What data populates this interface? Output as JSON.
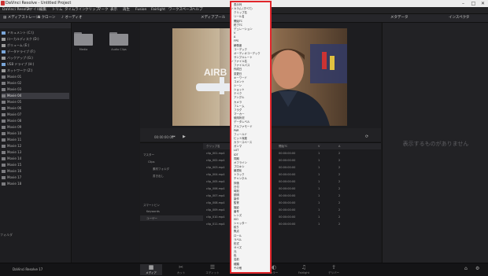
{
  "window": {
    "title": "DaVinci Resolve - Untitled Project"
  },
  "menubar": {
    "items": [
      "DaVinci Resolve",
      "ファイル",
      "編集",
      "トリム",
      "タイムライン",
      "クリップ",
      "マーク",
      "表示",
      "再生",
      "Fusion",
      "Fairlight",
      "ワークスペース",
      "ヘルプ"
    ]
  },
  "toolbar": {
    "media_storage": "メディアストレージ",
    "clone": "クローン",
    "audio": "オーディオ",
    "media_pool": "メディアプール",
    "metadata": "メタデータ",
    "inspector": "インスペクタ"
  },
  "left_panel": {
    "items": [
      {
        "label": "ドキュメント (C:\\)",
        "sel": false
      },
      {
        "label": "ローカルディスク (D:)",
        "sel": false
      },
      {
        "label": "ボリューム (E:)",
        "sel": false
      },
      {
        "label": "データドライブ (F:)",
        "sel": false
      },
      {
        "label": "バックアップ (G:)",
        "sel": false
      },
      {
        "label": "USB ドライブ (H:)",
        "sel": false
      },
      {
        "label": "ネットワーク (Z:)",
        "sel": false
      },
      {
        "label": "Movie 01",
        "sel": false
      },
      {
        "label": "Movie 02",
        "sel": false
      },
      {
        "label": "Movie 03",
        "sel": false
      },
      {
        "label": "Movie 04",
        "sel": true
      },
      {
        "label": "Movie 05",
        "sel": false
      },
      {
        "label": "Movie 06",
        "sel": false
      },
      {
        "label": "Movie 07",
        "sel": false
      },
      {
        "label": "Movie 08",
        "sel": false
      },
      {
        "label": "Movie 09",
        "sel": false
      },
      {
        "label": "Movie 10",
        "sel": false
      },
      {
        "label": "Movie 11",
        "sel": false
      },
      {
        "label": "Movie 12",
        "sel": false
      },
      {
        "label": "Movie 13",
        "sel": false
      },
      {
        "label": "Movie 14",
        "sel": false
      },
      {
        "label": "Movie 15",
        "sel": false
      },
      {
        "label": "Movie 16",
        "sel": false
      },
      {
        "label": "Movie 17",
        "sel": false
      },
      {
        "label": "Movie 18",
        "sel": false
      }
    ],
    "footer": "フォルダ"
  },
  "bin": {
    "folders": [
      "Media",
      "Audio Clips"
    ]
  },
  "viewer": {
    "timecode": "00:00:00:00"
  },
  "mediapool": {
    "tree": [
      "マスター",
      "Clips",
      "素材フォルダ",
      "書き出し"
    ],
    "smart_bins": "スマートビン",
    "smart_items": [
      "Keywords",
      "ユーザー"
    ],
    "columns": [
      "クリップ名",
      "リール名",
      "開始TC",
      "V",
      "A"
    ],
    "rows": [
      [
        "clip_001.mp4",
        "",
        "00:00:00:00",
        "1",
        "2"
      ],
      [
        "clip_002.mp4",
        "",
        "00:00:00:00",
        "1",
        "2"
      ],
      [
        "clip_003.mp4",
        "",
        "00:00:00:00",
        "1",
        "2"
      ],
      [
        "clip_004.mp4",
        "",
        "00:00:00:00",
        "1",
        "2"
      ],
      [
        "clip_005.mp4",
        "",
        "00:00:00:00",
        "1",
        "2"
      ],
      [
        "clip_006.mp4",
        "",
        "00:00:00:00",
        "1",
        "2"
      ],
      [
        "clip_007.mp4",
        "",
        "00:00:00:00",
        "1",
        "2"
      ],
      [
        "clip_008.mp4",
        "",
        "00:00:00:00",
        "1",
        "2"
      ],
      [
        "clip_009.mp4",
        "",
        "00:00:00:00",
        "1",
        "2"
      ],
      [
        "clip_010.mp4",
        "",
        "00:00:00:00",
        "1",
        "2"
      ],
      [
        "clip_011.mp4",
        "",
        "00:00:00:00",
        "1",
        "2"
      ]
    ]
  },
  "inspector": {
    "empty_text": "表示するものがありません"
  },
  "pagebar": {
    "project": "DaVinci Resolve 17",
    "pages": [
      {
        "glyph": "▦",
        "label": "メディア",
        "active": true
      },
      {
        "glyph": "✂",
        "label": "カット",
        "active": false
      },
      {
        "glyph": "☰",
        "label": "エディット",
        "active": false
      },
      {
        "glyph": "◎",
        "label": "Fusion",
        "active": false
      },
      {
        "glyph": "◐",
        "label": "カラー",
        "active": false
      },
      {
        "glyph": "♫",
        "label": "Fairlight",
        "active": false
      },
      {
        "glyph": "⇪",
        "label": "デリバー",
        "active": false
      }
    ]
  },
  "dropdown": {
    "items": [
      {
        "label": "表示列",
        "check": false
      },
      {
        "label": "カラム (すべて)",
        "check": true
      },
      {
        "label": "クリップ名",
        "check": false
      },
      {
        "label": "リール名",
        "check": false
      },
      {
        "label": "開始TC",
        "check": false
      },
      {
        "label": "終了TC",
        "check": false
      },
      {
        "label": "デュレーション",
        "check": false
      },
      {
        "label": "V",
        "check": false
      },
      {
        "label": "A",
        "check": false
      },
      {
        "label": "FPS",
        "check": false
      },
      {
        "label": "解像度",
        "check": false
      },
      {
        "label": "コーデック",
        "check": false
      },
      {
        "label": "オーディオコーデック",
        "check": false
      },
      {
        "label": "サンプルレート",
        "check": false
      },
      {
        "label": "ファイル名",
        "check": true
      },
      {
        "label": "ファイルパス",
        "check": false
      },
      {
        "label": "作成日",
        "check": false
      },
      {
        "label": "変更日",
        "check": false
      },
      {
        "label": "キーワード",
        "check": false
      },
      {
        "label": "コメント",
        "check": false
      },
      {
        "label": "シーン",
        "check": false
      },
      {
        "label": "ショット",
        "check": false
      },
      {
        "label": "テイク",
        "check": false
      },
      {
        "label": "アングル",
        "check": false
      },
      {
        "label": "カメラ",
        "check": false
      },
      {
        "label": "フレーム",
        "check": false
      },
      {
        "label": "フラグ",
        "check": false
      },
      {
        "label": "マーカー",
        "check": false
      },
      {
        "label": "使用状況",
        "check": false
      },
      {
        "label": "データレベル",
        "check": false
      },
      {
        "label": "アルファモード",
        "check": false
      },
      {
        "label": "PAR",
        "check": false
      },
      {
        "label": "フィールド",
        "check": false
      },
      {
        "label": "ビット深度",
        "check": false
      },
      {
        "label": "カラースペース",
        "check": false
      },
      {
        "label": "ガンマ",
        "check": false
      },
      {
        "label": "LUT",
        "check": false
      },
      {
        "label": "IDT",
        "check": false
      },
      {
        "label": "同期",
        "check": false
      },
      {
        "label": "オフライン",
        "check": false
      },
      {
        "label": "プロキシ",
        "check": false
      },
      {
        "label": "最適化",
        "check": false
      },
      {
        "label": "トラック",
        "check": false
      },
      {
        "label": "チャンネル",
        "check": false
      },
      {
        "label": "評価",
        "check": false
      },
      {
        "label": "日付",
        "check": false
      },
      {
        "label": "時刻",
        "check": false
      },
      {
        "label": "説明",
        "check": false
      },
      {
        "label": "製作",
        "check": false
      },
      {
        "label": "監督",
        "check": false
      },
      {
        "label": "撮影",
        "check": false
      },
      {
        "label": "番号",
        "check": false
      },
      {
        "label": "レンズ",
        "check": false
      },
      {
        "label": "ISO",
        "check": false
      },
      {
        "label": "シャッター",
        "check": false
      },
      {
        "label": "絞り",
        "check": false
      },
      {
        "label": "焦点",
        "check": false
      },
      {
        "label": "ロール",
        "check": false
      },
      {
        "label": "ラベル",
        "check": false
      },
      {
        "label": "形式",
        "check": false
      },
      {
        "label": "サイズ",
        "check": false
      },
      {
        "label": "元",
        "check": false
      },
      {
        "label": "色",
        "check": false
      },
      {
        "label": "名前",
        "check": false
      },
      {
        "label": "種類",
        "check": false
      },
      {
        "label": "その他",
        "check": false
      }
    ]
  },
  "colors": {
    "highlight": "#e1262b",
    "bg": "#1b1b1d"
  }
}
